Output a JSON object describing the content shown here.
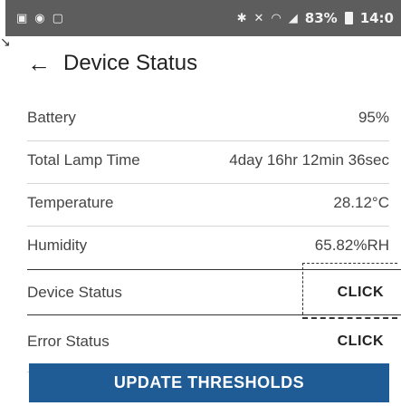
{
  "status_bar": {
    "left_icons": [
      "image-icon",
      "location-icon",
      "screenshot-icon"
    ],
    "right_icons": [
      "bluetooth-icon",
      "mute-icon",
      "wifi-icon",
      "signal-icon"
    ],
    "battery": "83%",
    "time": "14:0"
  },
  "header": {
    "title": "Device Status"
  },
  "rows": [
    {
      "label": "Battery",
      "value": "95%"
    },
    {
      "label": "Total Lamp Time",
      "value": "4day 16hr 12min 36sec"
    },
    {
      "label": "Temperature",
      "value": "28.12°C"
    },
    {
      "label": "Humidity",
      "value": "65.82%RH"
    },
    {
      "label": "Device Status",
      "value": "CLICK"
    },
    {
      "label": "Error Status",
      "value": "CLICK"
    }
  ],
  "button": {
    "label": "UPDATE THRESHOLDS"
  }
}
